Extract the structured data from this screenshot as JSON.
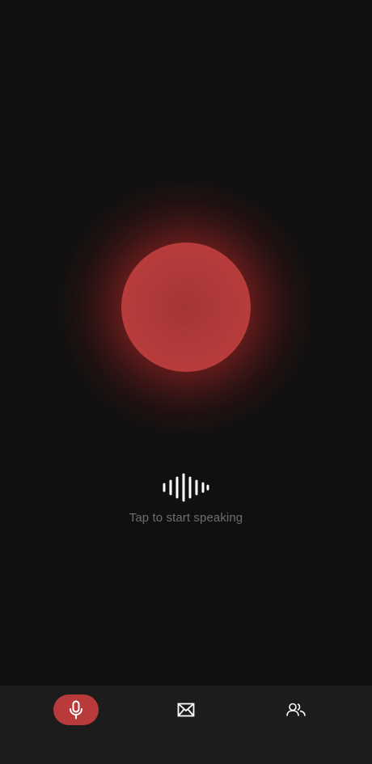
{
  "main": {
    "hint_text": "Tap to start speaking",
    "record_button_icon": "record-orb",
    "waveform_icon": "waveform-icon"
  },
  "bottom_nav": {
    "items": [
      {
        "icon": "microphone-icon",
        "active": true
      },
      {
        "icon": "mail-icon",
        "active": false
      },
      {
        "icon": "people-icon",
        "active": false
      }
    ]
  },
  "colors": {
    "background": "#101010",
    "accent": "#b93a3a",
    "nav_background": "#1c1c1c",
    "hint_text": "#6e6e6e",
    "icon": "#ffffff"
  }
}
